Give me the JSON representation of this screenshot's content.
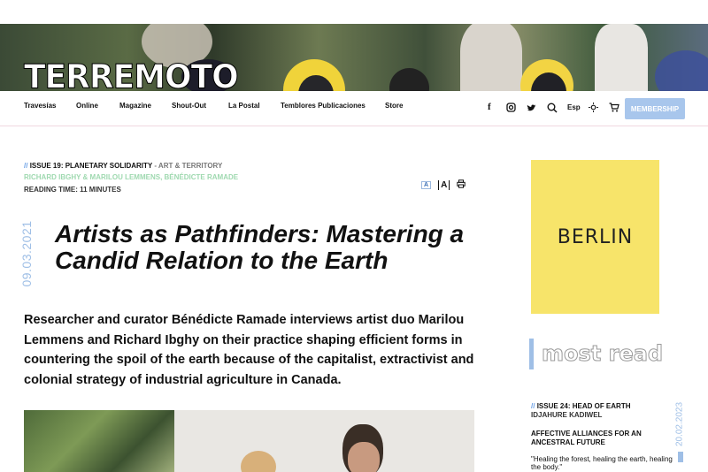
{
  "site": {
    "logo": "TERREMOTO"
  },
  "nav": {
    "items": [
      "Travesías",
      "Online",
      "Magazine",
      "Shout-Out",
      "La Postal",
      "Temblores Publicaciones",
      "Store"
    ],
    "lang": "Esp",
    "membership": "MEMBERSHIP",
    "icons": [
      "facebook-icon",
      "instagram-icon",
      "twitter-icon",
      "search-icon",
      "sun-icon",
      "cart-icon"
    ]
  },
  "article": {
    "issue_prefix": "//",
    "issue": "ISSUE 19: PLANETARY SOLIDARITY",
    "category": "- ART & TERRITORY",
    "authors": "RICHARD IBGHY & MARILOU LEMMENS, BÉNÉDICTE RAMADE",
    "reading_time": "READING TIME: 11 MINUTES",
    "font_small": "A",
    "font_large": "A",
    "date": "09.03.2021",
    "title": "Artists as Pathfinders: Mastering a Candid Relation to the Earth",
    "lead": "Researcher and curator Bénédicte Ramade interviews artist duo Marilou Lemmens and Richard Ibghy on their practice shaping efficient forms in countering the spoil of the earth because of the capitalist, extractivist and colonial strategy of industrial agriculture in Canada."
  },
  "sidebar": {
    "ad_text": "BERLIN",
    "most_read_heading": "most read",
    "item": {
      "issue_prefix": "//",
      "issue": "ISSUE 24: HEAD OF EARTH",
      "author": "IDJAHURE KADIWEL",
      "title": "AFFECTIVE ALLIANCES FOR AN ANCESTRAL FUTURE",
      "quote": "\"Healing the forest, healing the earth, healing the body.\"",
      "date": "20.02.2023"
    }
  },
  "colors": {
    "accent_blue": "#a8c6ec",
    "author_green": "#9fd9b0",
    "ad_yellow": "#f7e46a"
  }
}
